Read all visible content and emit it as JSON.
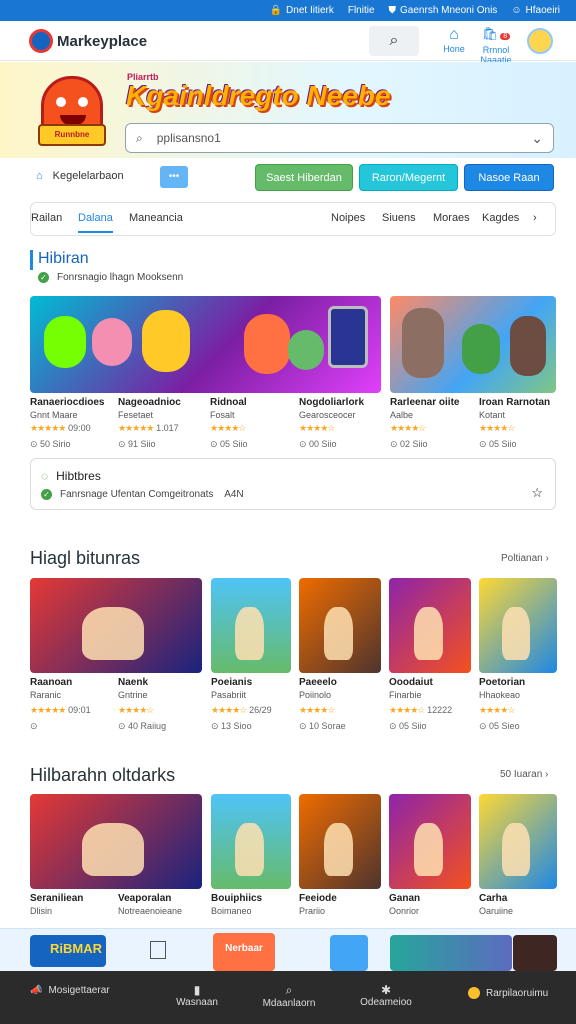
{
  "topbar": {
    "links": [
      "Dnet Iitierk",
      "Flnitie",
      "Gaenrsh Mneoni Onis",
      "Hfaoeiri"
    ]
  },
  "header": {
    "logo_text": "Markeyplace",
    "home_label": "Hone",
    "cart_label": "Rrnnol Naaatie",
    "cart_count": "8"
  },
  "hero": {
    "mini_text": "Pliarrtb",
    "title": "Kgainldregto Neebe",
    "mascot_label": "Runnbne Poniimes",
    "search_placeholder": "pplisansno1"
  },
  "filters": {
    "location": "Kegelelarbaon",
    "loc_btn": "•••",
    "btn1": "Saest Hiberdan",
    "btn2": "Raron/Megernt",
    "btn3": "Nasoe Raan"
  },
  "tabs": {
    "left": [
      "Railan",
      "Dalana",
      "Maneancia"
    ],
    "active_index": 1,
    "right": [
      "Noipes",
      "Siuens",
      "Moraes",
      "Kagdes"
    ]
  },
  "section1": {
    "title": "Hibiran",
    "subtitle": "Fonrsnagio lhagn Mooksenn"
  },
  "items1": [
    {
      "name": "Ranaeriocdioes",
      "sub": "Gnnt Maare",
      "rating": 4.5,
      "rating_text": "09:00",
      "plays": "50 Sirio"
    },
    {
      "name": "Nageoadnioc",
      "sub": "Fesetaet",
      "rating": 4.5,
      "rating_text": "1.017",
      "plays": "91 Siio"
    },
    {
      "name": "Ridnoal",
      "sub": "Fosalt",
      "rating": 3.5,
      "rating_text": "",
      "plays": "05 Siio"
    },
    {
      "name": "Nogdoliarlork",
      "sub": "Gearosceocer",
      "rating": 3.5,
      "rating_text": "",
      "plays": "00 Siio"
    },
    {
      "name": "Rarleenar oiite",
      "sub": "Aalbe",
      "rating": 4,
      "rating_text": "",
      "plays": "02 Siio"
    },
    {
      "name": "Iroan Rarnotan",
      "sub": "Kotant",
      "rating": 3.5,
      "rating_text": "",
      "plays": "05 Siio"
    }
  ],
  "notice": {
    "title": "Hibtbres",
    "text": "Fanrsnage Ufentan Comgeitronats",
    "tag": "A4N"
  },
  "section2": {
    "title": "Hiagl bitunras",
    "see_all": "Poltianan ›"
  },
  "items2": [
    {
      "name": "Raanoan",
      "sub": "Raranic",
      "rating": 4.5,
      "rating_text": "09:01",
      "plays": ""
    },
    {
      "name": "Naenk",
      "sub": "Gntrine",
      "rating": 3.5,
      "rating_text": "",
      "plays": "40 Raiiug"
    },
    {
      "name": "Poeianis",
      "sub": "Pasabriit",
      "rating": 4,
      "rating_text": "26/29",
      "plays": "13 Sioo"
    },
    {
      "name": "Paeeelo",
      "sub": "Poiinolo",
      "rating": 3.5,
      "rating_text": "",
      "plays": "10 Sorae"
    },
    {
      "name": "Ooodaiut",
      "sub": "Finarbie",
      "rating": 3.5,
      "rating_text": "12222",
      "plays": "05 Siio"
    },
    {
      "name": "Poetorian",
      "sub": "Hhaokeao",
      "rating": 3.5,
      "rating_text": "",
      "plays": "05 Sieo"
    }
  ],
  "section3": {
    "title": "Hilbarahn oltdarks",
    "see_all": "50 Iuaran ›"
  },
  "items3": [
    {
      "name": "Seraniliean",
      "sub": "Dlisin"
    },
    {
      "name": "Veaporalan",
      "sub": "Notreaenoieane"
    },
    {
      "name": "Bouiphiics",
      "sub": "Boimaneo"
    },
    {
      "name": "Feeiode",
      "sub": "Prariio"
    },
    {
      "name": "Ganan",
      "sub": "Oonrior"
    },
    {
      "name": "Carha",
      "sub": "Oaruiine"
    }
  ],
  "strip": {
    "label1": "RiBMAR",
    "label2": "Nerbaar"
  },
  "bottom_nav": {
    "items": [
      "Mosigettaerar",
      "Wasnaan",
      "Mdaanlaorn",
      "Odeameioo",
      "Rarpilaoruimu"
    ]
  },
  "colors": {
    "primary": "#1e88e5",
    "topbar": "#1976d2",
    "star": "#f9a825",
    "nav_bg": "#2b2b2b"
  }
}
